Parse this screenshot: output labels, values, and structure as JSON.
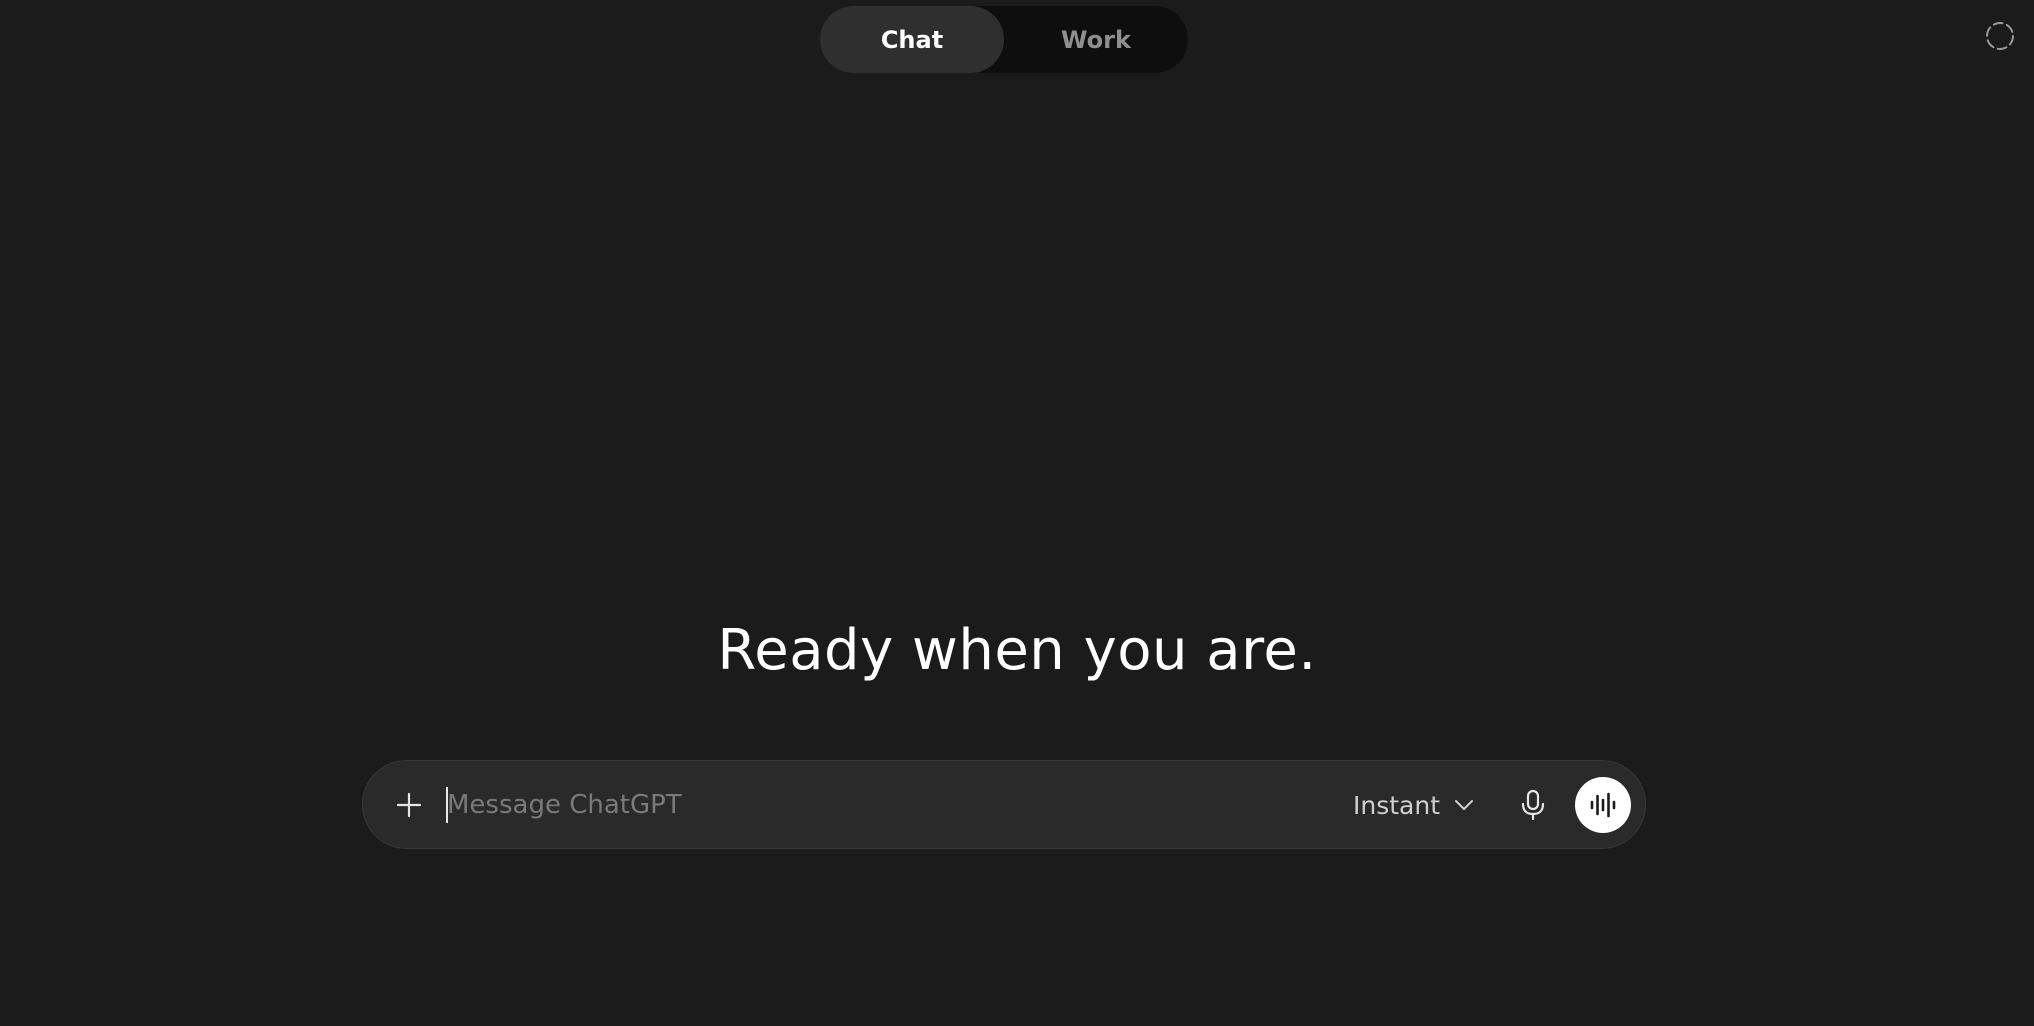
{
  "mode_toggle": {
    "tabs": [
      {
        "label": "Chat",
        "active": true
      },
      {
        "label": "Work",
        "active": false
      }
    ]
  },
  "header": {
    "temporary_chat_icon": "dashed-circle-icon"
  },
  "main": {
    "greeting": "Ready when you are."
  },
  "composer": {
    "placeholder": "Message ChatGPT",
    "value": "",
    "add_icon": "plus-icon",
    "model_selector": {
      "selected": "Instant",
      "icon": "chevron-down-icon"
    },
    "dictate_icon": "microphone-icon",
    "voice_icon": "voice-waveform-icon"
  },
  "colors": {
    "background": "#1b1b1b",
    "composer_bg": "#2a2a2a",
    "toggle_bg": "#0e0e0e",
    "active_tab_bg": "#2f2f2f",
    "placeholder_text": "#7a7a7a",
    "voice_button_bg": "#ffffff"
  }
}
